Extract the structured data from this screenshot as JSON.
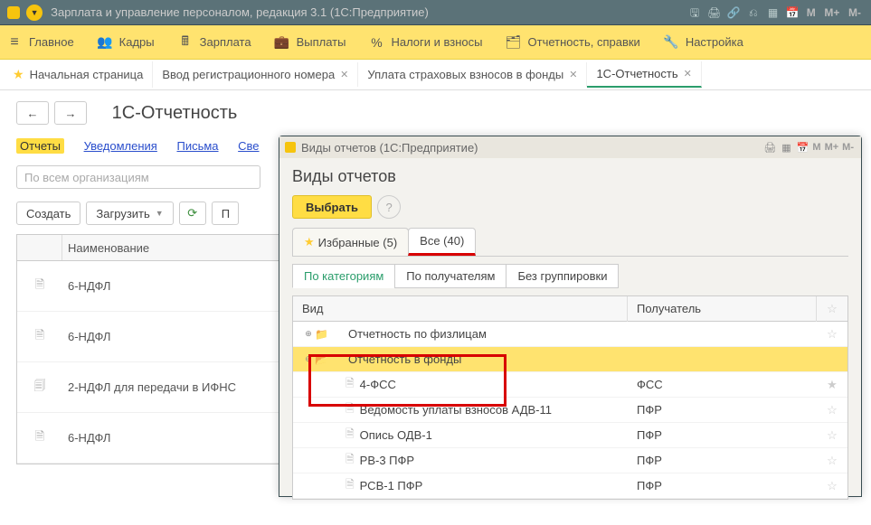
{
  "app": {
    "title": "Зарплата и управление персоналом, редакция 3.1  (1С:Предприятие)",
    "mbuttons": [
      "M",
      "M+",
      "M-"
    ]
  },
  "menu": {
    "items": [
      {
        "icon": "≡",
        "label": "Главное"
      },
      {
        "icon": "👥",
        "label": "Кадры"
      },
      {
        "icon": "🖩",
        "label": "Зарплата"
      },
      {
        "icon": "💼",
        "label": "Выплаты"
      },
      {
        "icon": "%",
        "label": "Налоги и взносы"
      },
      {
        "icon": "🗂",
        "label": "Отчетность, справки"
      },
      {
        "icon": "🔧",
        "label": "Настройка"
      }
    ]
  },
  "tabs": {
    "items": [
      {
        "icon": "★",
        "label": "Начальная страница",
        "closable": false
      },
      {
        "label": "Ввод регистрационного номера",
        "closable": true
      },
      {
        "label": "Уплата страховых взносов в фонды",
        "closable": true
      },
      {
        "label": "1С-Отчетность",
        "closable": true,
        "active": true
      }
    ]
  },
  "page": {
    "title": "1С-Отчетность",
    "subtabs": [
      {
        "label": "Отчеты",
        "active": true
      },
      {
        "label": "Уведомления"
      },
      {
        "label": "Письма"
      },
      {
        "label": "Све"
      }
    ],
    "search_placeholder": "По всем организациям",
    "buttons": {
      "create": "Создать",
      "load": "Загрузить",
      "print": "П"
    },
    "grid": {
      "header": "Наименование",
      "rows": [
        {
          "icon": "doc",
          "label": "6-НДФЛ"
        },
        {
          "icon": "doc",
          "label": "6-НДФЛ"
        },
        {
          "icon": "copy",
          "label": "2-НДФЛ для передачи в ИФНС"
        },
        {
          "icon": "doc",
          "label": "6-НДФЛ"
        }
      ]
    }
  },
  "modal": {
    "window_title": "Виды отчетов  (1С:Предприятие)",
    "title": "Виды отчетов",
    "select": "Выбрать",
    "tabs": {
      "fav": "Избранные (5)",
      "all": "Все (40)"
    },
    "group_tabs": [
      "По категориям",
      "По получателям",
      "Без группировки"
    ],
    "tree": {
      "head_a": "Вид",
      "head_b": "Получатель",
      "rows": [
        {
          "type": "folder",
          "expand": "⊕",
          "label": "Отчетность по физлицам",
          "recipient": ""
        },
        {
          "type": "folder",
          "expand": "⊖",
          "label": "Отчетность в фонды",
          "recipient": "",
          "hl": true
        },
        {
          "type": "file",
          "indent": 2,
          "label": "4-ФСС",
          "recipient": "ФСС",
          "star": true,
          "hl2": true
        },
        {
          "type": "file",
          "indent": 2,
          "label": "Ведомость уплаты взносов АДВ-11",
          "recipient": "ПФР"
        },
        {
          "type": "file",
          "indent": 2,
          "label": "Опись ОДВ-1",
          "recipient": "ПФР"
        },
        {
          "type": "file",
          "indent": 2,
          "label": "РВ-3 ПФР",
          "recipient": "ПФР"
        },
        {
          "type": "file",
          "indent": 2,
          "label": "РСВ-1 ПФР",
          "recipient": "ПФР"
        }
      ]
    },
    "mbuttons": [
      "M",
      "M+",
      "M-"
    ]
  }
}
